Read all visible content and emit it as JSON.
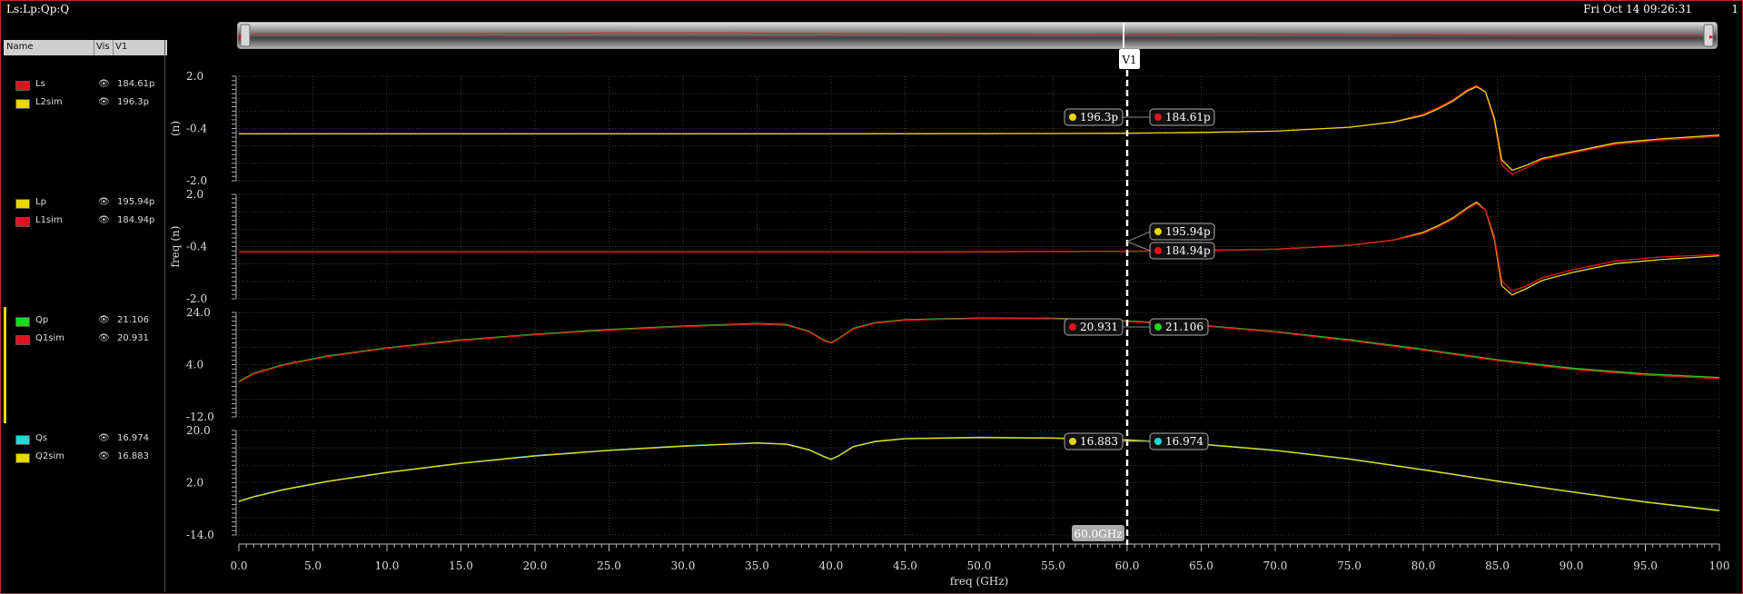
{
  "window": {
    "title": "Ls:Lp:Qp:Q",
    "timestamp": "Fri Oct 14 09:26:31",
    "index": "1"
  },
  "legend": {
    "headers": {
      "name": "Name",
      "vis": "Vis",
      "v1": "V1"
    },
    "eye_glyph": "👁",
    "groups": [
      [
        {
          "name": "Ls",
          "color": "#e0141e",
          "value": "184.61p"
        },
        {
          "name": "L2sim",
          "color": "#e8d800",
          "value": "196.3p"
        }
      ],
      [
        {
          "name": "Lp",
          "color": "#e8d800",
          "value": "195.94p"
        },
        {
          "name": "L1sim",
          "color": "#e0141e",
          "value": "184.94p"
        }
      ],
      [
        {
          "name": "Qp",
          "color": "#1ed81e",
          "value": "21.106"
        },
        {
          "name": "Q1sim",
          "color": "#e0141e",
          "value": "20.931"
        }
      ],
      [
        {
          "name": "Qs",
          "color": "#1ed8d8",
          "value": "16.974"
        },
        {
          "name": "Q2sim",
          "color": "#e8d800",
          "value": "16.883"
        }
      ]
    ]
  },
  "cursor": {
    "label": "V1",
    "x_readout": "60.0GHz",
    "markers": [
      {
        "panel": 0,
        "left": {
          "color": "#e8d800",
          "text": "196.3p"
        },
        "right": {
          "color": "#e0141e",
          "text": "184.61p"
        }
      },
      {
        "panel": 1,
        "stacked": [
          {
            "color": "#e8d800",
            "text": "195.94p"
          },
          {
            "color": "#e0141e",
            "text": "184.94p"
          }
        ]
      },
      {
        "panel": 2,
        "left": {
          "color": "#e0141e",
          "text": "20.931"
        },
        "right": {
          "color": "#1ed81e",
          "text": "21.106"
        }
      },
      {
        "panel": 3,
        "left": {
          "color": "#e8d800",
          "text": "16.883"
        },
        "right": {
          "color": "#1ed8d8",
          "text": "16.974"
        }
      }
    ]
  },
  "chart_data": {
    "type": "line",
    "xlabel": "freq (GHz)",
    "xlim": [
      0,
      100
    ],
    "xticks": [
      "0.0",
      "5.0",
      "10.0",
      "15.0",
      "20.0",
      "25.0",
      "30.0",
      "35.0",
      "40.0",
      "45.0",
      "50.0",
      "55.0",
      "60.0",
      "65.0",
      "70.0",
      "75.0",
      "80.0",
      "85.0",
      "90.0",
      "95.0",
      "100"
    ],
    "cursor_x": 60,
    "grid": true,
    "panels": [
      {
        "ylabel": "(n)",
        "ylim": [
          -2.0,
          2.0
        ],
        "yticks": [
          "2.0",
          "-0.4",
          "-2.0"
        ],
        "series": [
          {
            "name": "Ls",
            "color": "#e0141e",
            "x": [
              0,
              20,
              40,
              55,
              60,
              65,
              70,
              75,
              78,
              80,
              81,
              82,
              83,
              83.6,
              84.2,
              84.8,
              85.3,
              86,
              87,
              88,
              90,
              93,
              96,
              100
            ],
            "y": [
              -0.2,
              -0.2,
              -0.2,
              -0.19,
              -0.18,
              -0.15,
              -0.1,
              0.05,
              0.25,
              0.55,
              0.8,
              1.1,
              1.5,
              1.65,
              1.4,
              0.3,
              -1.4,
              -1.75,
              -1.5,
              -1.2,
              -0.95,
              -0.6,
              -0.45,
              -0.3
            ]
          },
          {
            "name": "L2sim",
            "color": "#e8d800",
            "x": [
              0,
              20,
              40,
              55,
              60,
              65,
              70,
              75,
              78,
              80,
              81,
              82,
              83,
              83.6,
              84.2,
              84.8,
              85.3,
              86,
              87,
              88,
              90,
              93,
              96,
              100
            ],
            "y": [
              -0.2,
              -0.2,
              -0.2,
              -0.19,
              -0.18,
              -0.15,
              -0.1,
              0.05,
              0.25,
              0.5,
              0.75,
              1.05,
              1.45,
              1.6,
              1.4,
              0.4,
              -1.2,
              -1.6,
              -1.4,
              -1.15,
              -0.9,
              -0.55,
              -0.4,
              -0.25
            ]
          }
        ]
      },
      {
        "ylabel": "freq (n)",
        "ylim": [
          -2.0,
          2.0
        ],
        "yticks": [
          "2.0",
          "-0.4",
          "-2.0"
        ],
        "series": [
          {
            "name": "Lp",
            "color": "#e8d800",
            "x": [
              0,
              20,
              40,
              55,
              60,
              65,
              70,
              75,
              78,
              80,
              81,
              82,
              83,
              83.6,
              84.2,
              84.8,
              85.3,
              86,
              87,
              88,
              90,
              93,
              96,
              100
            ],
            "y": [
              -0.2,
              -0.2,
              -0.2,
              -0.19,
              -0.18,
              -0.15,
              -0.1,
              0.05,
              0.25,
              0.55,
              0.8,
              1.1,
              1.5,
              1.7,
              1.4,
              0.3,
              -1.5,
              -1.85,
              -1.6,
              -1.3,
              -1.0,
              -0.65,
              -0.5,
              -0.35
            ]
          },
          {
            "name": "L1sim",
            "color": "#e0141e",
            "x": [
              0,
              20,
              40,
              55,
              60,
              65,
              70,
              75,
              78,
              80,
              81,
              82,
              83,
              83.6,
              84.2,
              84.8,
              85.3,
              86,
              87,
              88,
              90,
              93,
              96,
              100
            ],
            "y": [
              -0.2,
              -0.2,
              -0.2,
              -0.19,
              -0.18,
              -0.15,
              -0.1,
              0.05,
              0.25,
              0.5,
              0.75,
              1.05,
              1.45,
              1.65,
              1.4,
              0.4,
              -1.3,
              -1.7,
              -1.5,
              -1.2,
              -0.9,
              -0.55,
              -0.4,
              -0.3
            ]
          }
        ]
      },
      {
        "ylabel": "",
        "ylim": [
          -12.0,
          24.0
        ],
        "yticks": [
          "24.0",
          "4.0",
          "-12.0"
        ],
        "series": [
          {
            "name": "Qp",
            "color": "#1ed81e",
            "x": [
              0,
              1,
              3,
              6,
              10,
              15,
              20,
              25,
              30,
              35,
              37,
              38.5,
              39.5,
              40,
              40.5,
              41.5,
              43,
              45,
              50,
              55,
              60,
              65,
              70,
              75,
              80,
              85,
              90,
              95,
              100
            ],
            "y": [
              0.2,
              3.0,
              6.0,
              9.0,
              11.8,
              14.5,
              16.5,
              18.1,
              19.3,
              20.2,
              19.8,
              17.5,
              14.5,
              13.6,
              15.0,
              18.5,
              20.5,
              21.5,
              22.1,
              22.0,
              21.1,
              19.6,
              17.4,
              14.6,
              11.3,
              7.7,
              4.8,
              2.8,
              1.6
            ]
          },
          {
            "name": "Q1sim",
            "color": "#e0141e",
            "x": [
              0,
              1,
              3,
              6,
              10,
              15,
              20,
              25,
              30,
              35,
              37,
              38.5,
              39.5,
              40,
              40.5,
              41.5,
              43,
              45,
              50,
              55,
              60,
              65,
              70,
              75,
              80,
              85,
              90,
              95,
              100
            ],
            "y": [
              0.0,
              2.8,
              5.8,
              8.8,
              11.6,
              14.3,
              16.3,
              17.9,
              19.1,
              20.0,
              19.6,
              17.3,
              14.3,
              13.4,
              14.8,
              18.3,
              20.3,
              21.3,
              21.9,
              21.8,
              20.9,
              19.4,
              17.2,
              14.3,
              11.0,
              7.4,
              4.4,
              2.4,
              1.2
            ]
          }
        ]
      },
      {
        "ylabel": "",
        "ylim": [
          -14.0,
          20.0
        ],
        "yticks": [
          "20.0",
          "2.0",
          "-14.0"
        ],
        "series": [
          {
            "name": "Qs",
            "color": "#1ed8d8",
            "x": [
              0,
              1,
              3,
              6,
              10,
              15,
              20,
              25,
              30,
              35,
              37,
              38.5,
              39.5,
              40,
              40.5,
              41.5,
              43,
              45,
              50,
              55,
              60,
              65,
              70,
              75,
              80,
              85,
              90,
              95,
              100
            ],
            "y": [
              -3.0,
              -1.5,
              0.8,
              3.5,
              6.4,
              9.4,
              11.8,
              13.6,
              15.0,
              16.0,
              15.6,
              13.8,
              11.6,
              10.7,
              11.8,
              14.8,
              16.5,
              17.4,
              17.8,
              17.6,
              16.97,
              15.6,
              13.6,
              10.8,
              7.3,
              3.6,
              0.1,
              -3.2,
              -6.0
            ]
          },
          {
            "name": "Q2sim",
            "color": "#e8d800",
            "x": [
              0,
              1,
              3,
              6,
              10,
              15,
              20,
              25,
              30,
              35,
              37,
              38.5,
              39.5,
              40,
              40.5,
              41.5,
              43,
              45,
              50,
              55,
              60,
              65,
              70,
              75,
              80,
              85,
              90,
              95,
              100
            ],
            "y": [
              -3.1,
              -1.6,
              0.7,
              3.4,
              6.3,
              9.3,
              11.7,
              13.5,
              14.9,
              15.9,
              15.5,
              13.7,
              11.5,
              10.6,
              11.7,
              14.7,
              16.4,
              17.3,
              17.7,
              17.5,
              16.88,
              15.5,
              13.5,
              10.7,
              7.2,
              3.5,
              0.0,
              -3.3,
              -6.1
            ]
          }
        ]
      }
    ]
  }
}
